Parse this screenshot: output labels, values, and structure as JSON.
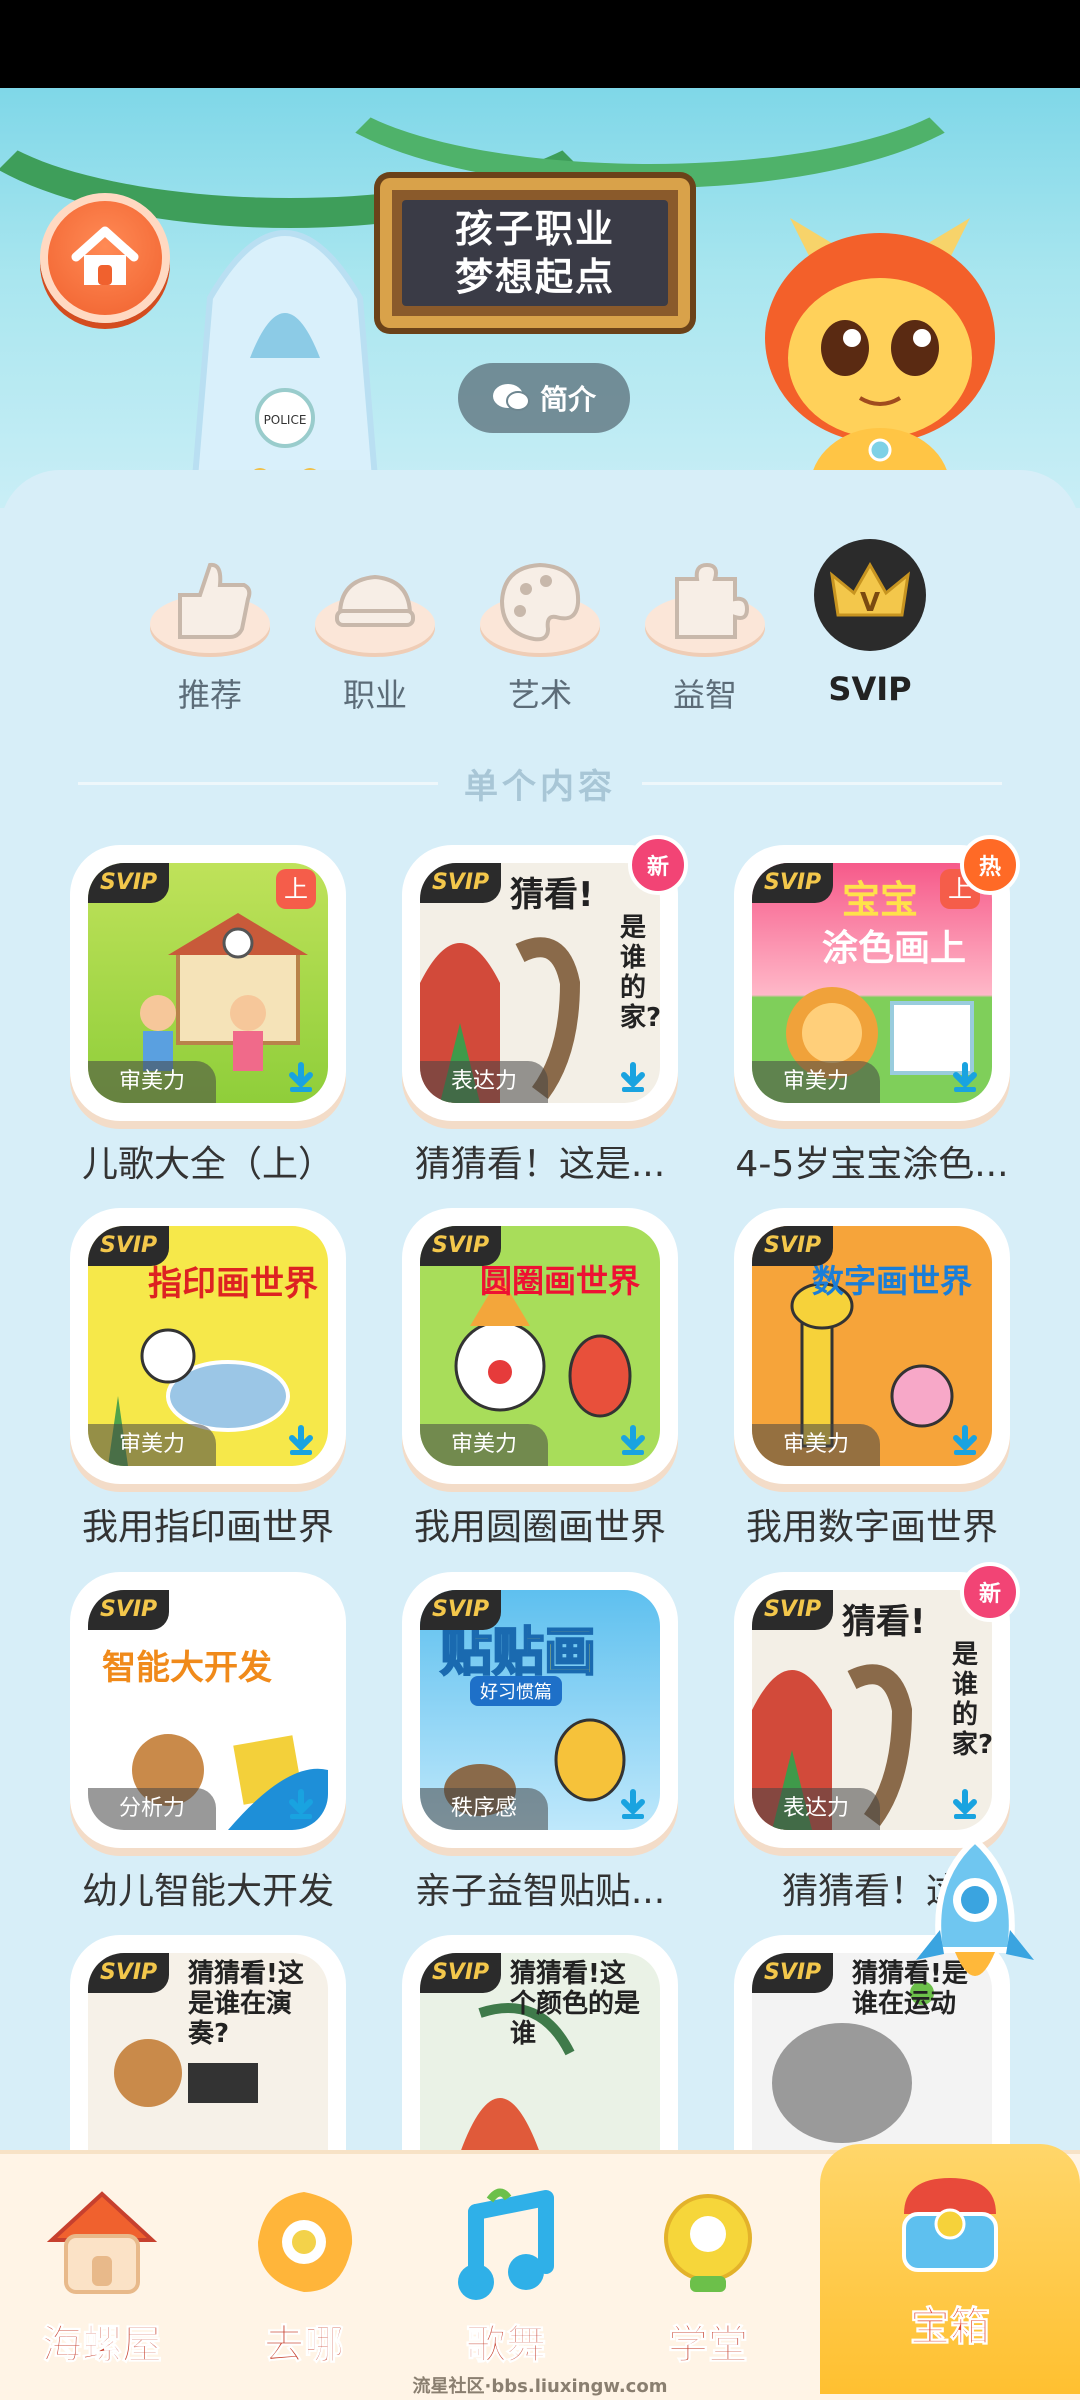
{
  "header": {
    "sign_line1": "孩子职业",
    "sign_line2": "梦想起点",
    "intro_label": "简介"
  },
  "categories": [
    {
      "label": "推荐",
      "icon": "thumbs-up-icon"
    },
    {
      "label": "职业",
      "icon": "cap-icon"
    },
    {
      "label": "艺术",
      "icon": "palette-icon"
    },
    {
      "label": "益智",
      "icon": "puzzle-icon"
    },
    {
      "label": "SVIP",
      "icon": "crown-icon",
      "active": true
    }
  ],
  "section_title": "单个内容",
  "cards": [
    {
      "title": "儿歌大全（上）",
      "tag": "审美力",
      "svip": "SVIP",
      "corner": "上",
      "badge": ""
    },
    {
      "title": "猜猜看！这是...",
      "tag": "表达力",
      "svip": "SVIP",
      "corner": "",
      "badge": "新"
    },
    {
      "title": "4-5岁宝宝涂色...",
      "tag": "审美力",
      "svip": "SVIP",
      "corner": "上",
      "badge": "热"
    },
    {
      "title": "我用指印画世界",
      "tag": "审美力",
      "svip": "SVIP",
      "corner": "",
      "badge": ""
    },
    {
      "title": "我用圆圈画世界",
      "tag": "审美力",
      "svip": "SVIP",
      "corner": "",
      "badge": ""
    },
    {
      "title": "我用数字画世界",
      "tag": "审美力",
      "svip": "SVIP",
      "corner": "",
      "badge": ""
    },
    {
      "title": "幼儿智能大开发",
      "tag": "分析力",
      "svip": "SVIP",
      "corner": "",
      "badge": ""
    },
    {
      "title": "亲子益智贴贴...",
      "tag": "秩序感",
      "svip": "SVIP",
      "corner": "",
      "badge": ""
    },
    {
      "title": "猜猜看！这",
      "tag": "表达力",
      "svip": "SVIP",
      "corner": "",
      "badge": "新"
    },
    {
      "title": "",
      "tag": "",
      "svip": "SVIP",
      "corner": "",
      "badge": ""
    },
    {
      "title": "",
      "tag": "",
      "svip": "SVIP",
      "corner": "",
      "badge": ""
    },
    {
      "title": "",
      "tag": "",
      "svip": "SVIP",
      "corner": "",
      "badge": ""
    }
  ],
  "cover_texts": {
    "c2": "猜看!",
    "c2b": "是谁的家?",
    "c3": "宝宝",
    "c3b": "涂色画上",
    "c4": "指印画世界",
    "c5": "圆圈画世界",
    "c6": "数字画世界",
    "c7": "智能大开发",
    "c8": "贴贴画",
    "c8b": "好习惯篇",
    "c9": "猜看!",
    "c9b": "是谁的家?",
    "c10": "猜猜看!这是谁在演奏?",
    "c11": "猜猜看!这个颜色的是谁",
    "c12": "猜猜看!是谁在运动"
  },
  "bottom_nav": [
    {
      "label": "海螺屋",
      "icon": "house-icon"
    },
    {
      "label": "去哪",
      "icon": "compass-icon"
    },
    {
      "label": "歌舞",
      "icon": "music-note-icon"
    },
    {
      "label": "学堂",
      "icon": "lightbulb-icon"
    },
    {
      "label": "宝箱",
      "icon": "treasure-chest-icon",
      "active": true
    }
  ],
  "watermark": "流星社区·bbs.liuxingw.com",
  "colors": {
    "accent_orange": "#f0612e",
    "svip_gold": "#f3c74b",
    "badge_new": "#f24475",
    "badge_hot": "#ff6a26",
    "nav_active": "#ffc030"
  }
}
